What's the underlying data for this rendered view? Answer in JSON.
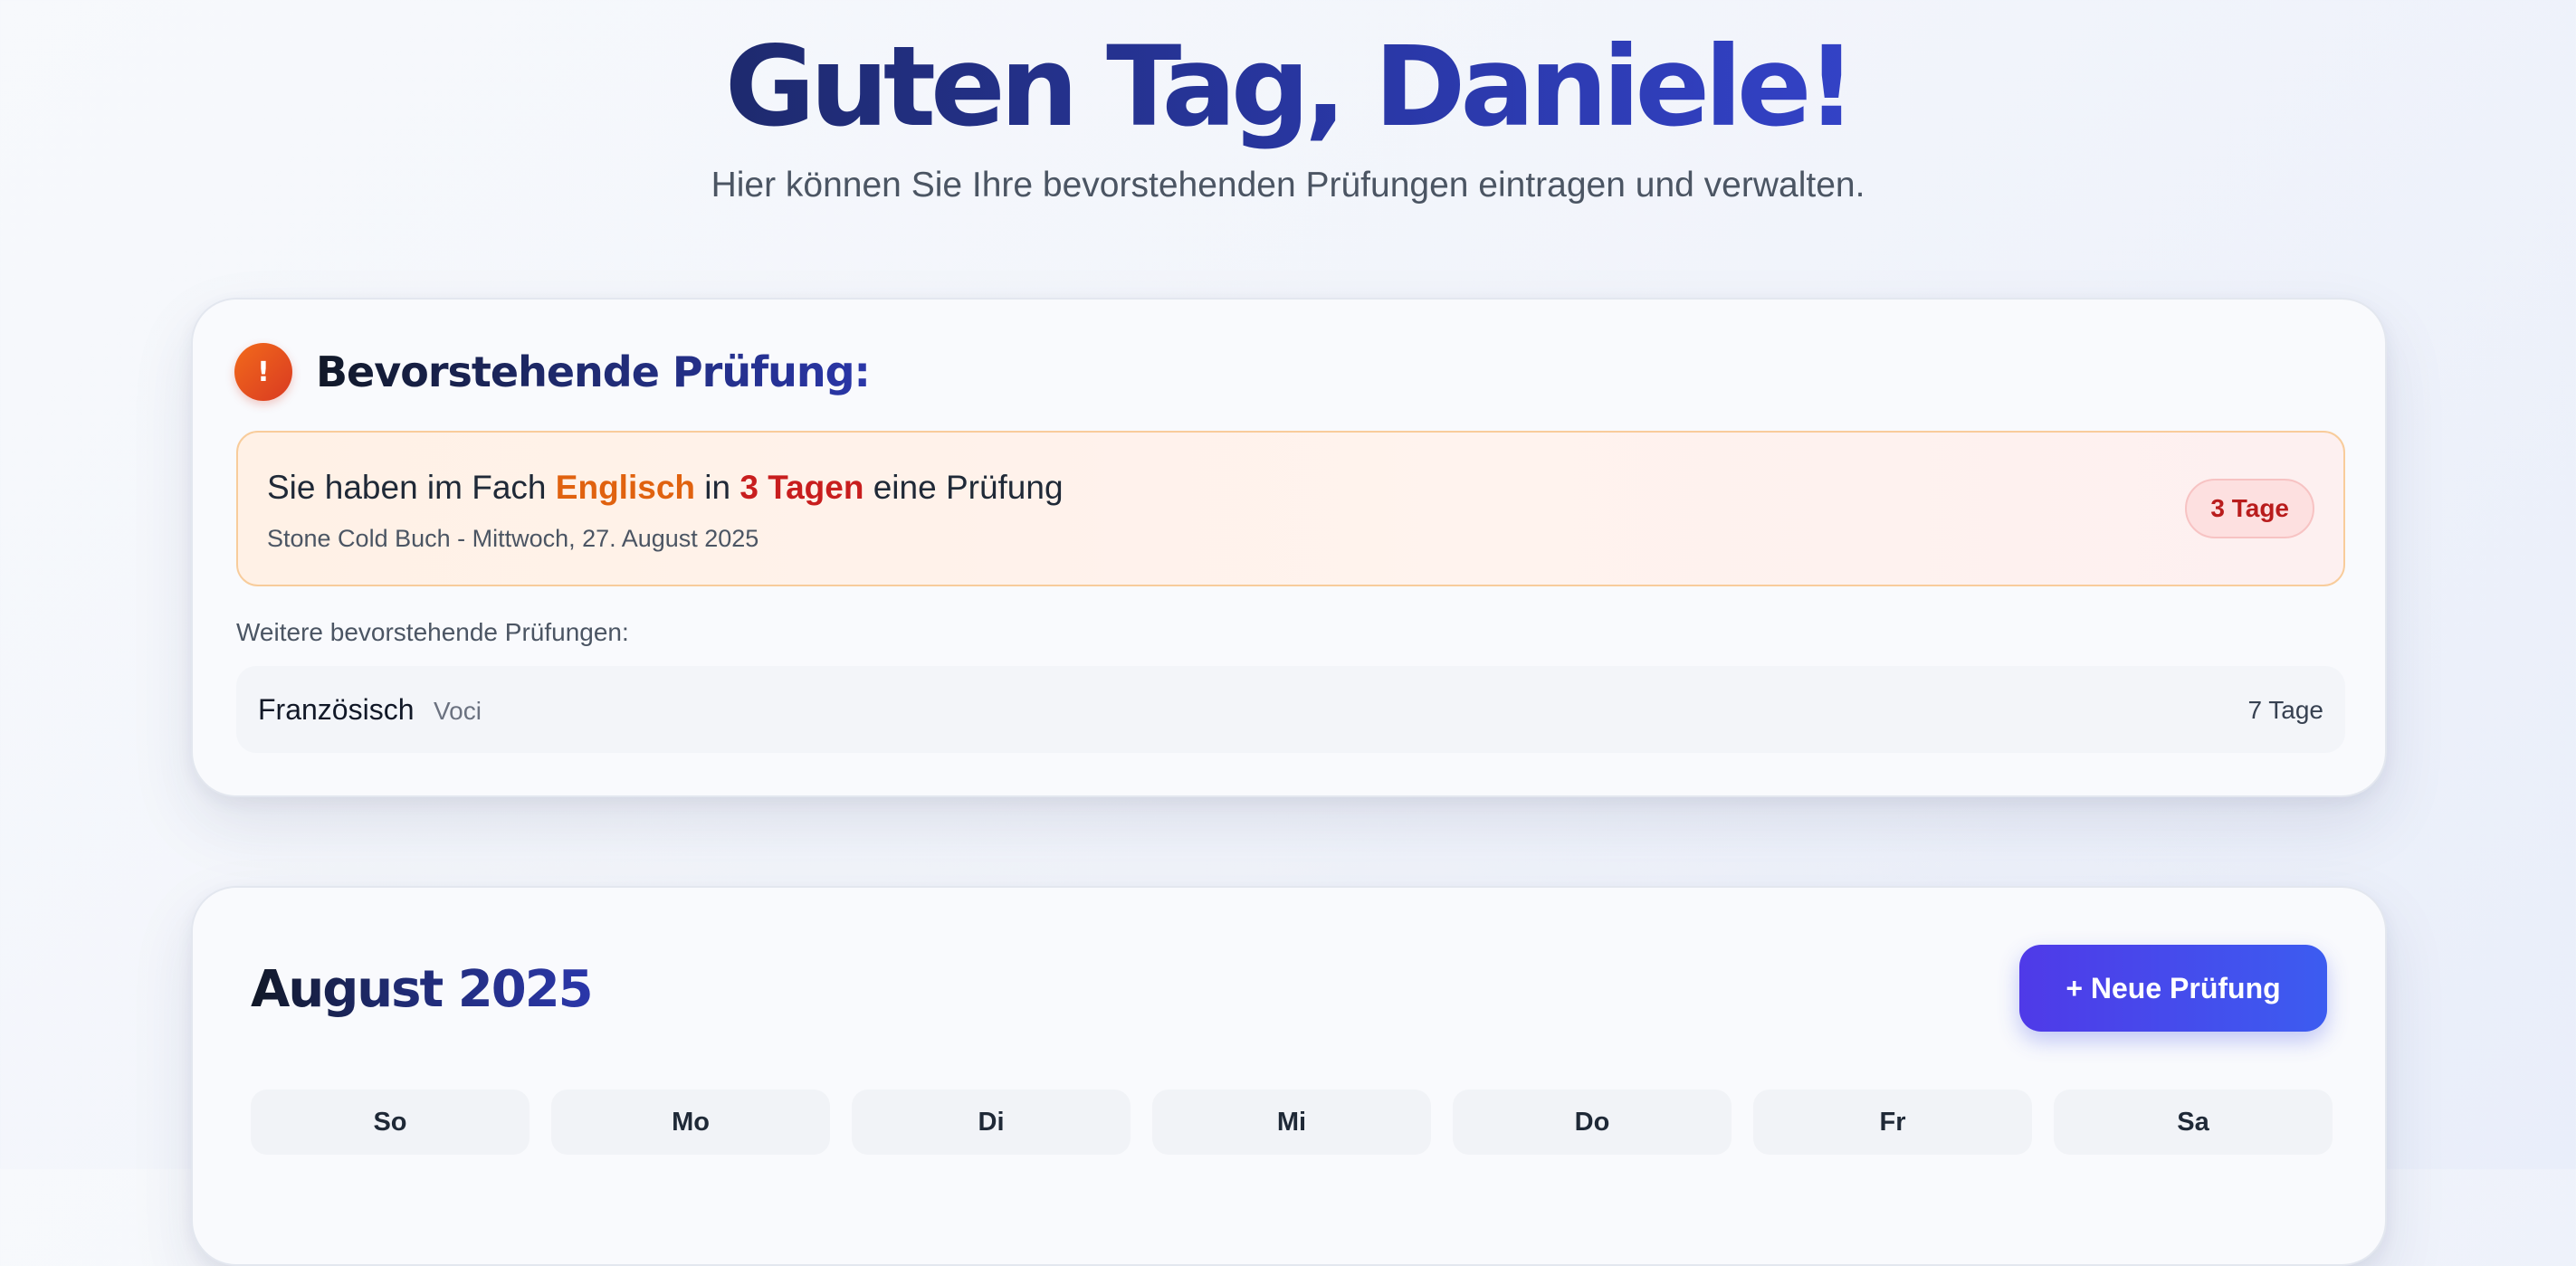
{
  "header": {
    "greeting": "Guten Tag, Daniele!",
    "subtitle": "Hier können Sie Ihre bevorstehenden Prüfungen eintragen und verwalten."
  },
  "upcoming": {
    "icon": "exclamation-icon",
    "icon_glyph": "!",
    "title": "Bevorstehende Prüfung:",
    "highlight": {
      "text_prefix": "Sie haben im Fach ",
      "subject": "Englisch",
      "text_in": " in ",
      "days_text": "3 Tagen",
      "text_suffix": " eine Prüfung",
      "detail": "Stone Cold Buch - Mittwoch, 27. August 2025",
      "badge": "3 Tage"
    },
    "further_label": "Weitere bevorstehende Prüfungen:",
    "further": [
      {
        "subject": "Französisch",
        "topic": "Voci",
        "days": "7 Tage"
      }
    ]
  },
  "calendar": {
    "month_label": "August 2025",
    "new_exam_button": "+ Neue Prüfung",
    "weekdays": [
      "So",
      "Mo",
      "Di",
      "Mi",
      "Do",
      "Fr",
      "Sa"
    ]
  },
  "colors": {
    "accent_orange": "#e0620f",
    "accent_red": "#c81e1e",
    "button_start": "#4f3ae8",
    "button_end": "#3c5cf0",
    "title_blue": "#2937a4"
  }
}
